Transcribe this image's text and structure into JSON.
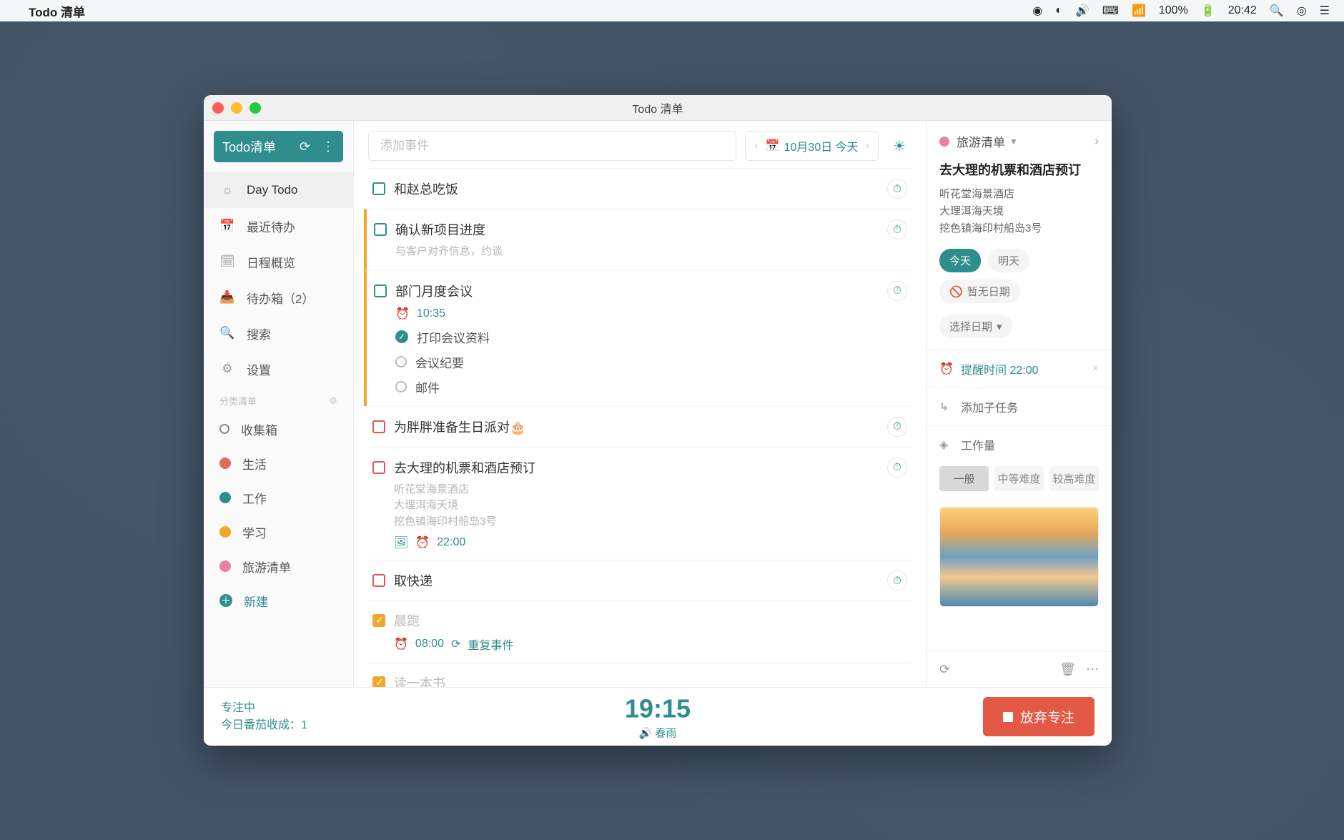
{
  "menubar": {
    "app_name": "Todo 清单",
    "battery": "100%",
    "time": "20:42"
  },
  "window": {
    "title": "Todo 清单"
  },
  "sidebar": {
    "brand": "Todo清单",
    "nav": [
      {
        "label": "Day Todo",
        "icon": "☼",
        "active": true
      },
      {
        "label": "最近待办",
        "icon": "📅"
      },
      {
        "label": "日程概览",
        "icon": "🗓"
      },
      {
        "label": "待办箱（2）",
        "icon": "📥"
      },
      {
        "label": "搜索",
        "icon": "🔍"
      },
      {
        "label": "设置",
        "icon": "⚙"
      }
    ],
    "categories_header": "分类清单",
    "categories": [
      {
        "label": "收集箱",
        "type": "outline"
      },
      {
        "label": "生活",
        "color": "#e06b5f"
      },
      {
        "label": "工作",
        "color": "#2f8d8d"
      },
      {
        "label": "学习",
        "color": "#f4a62a"
      },
      {
        "label": "旅游清单",
        "color": "#e97fa5"
      }
    ],
    "add_label": "新建"
  },
  "toolbar": {
    "placeholder": "添加事件",
    "date_label": "10月30日 今天"
  },
  "tasks": [
    {
      "title": "和赵总吃饭",
      "check": "teal"
    },
    {
      "title": "确认新项目进度",
      "check": "teal",
      "flag": true,
      "sub": "与客户对齐信息，约谈"
    },
    {
      "title": "部门月度会议",
      "check": "teal",
      "flag": true,
      "time": "10:35",
      "subtasks": [
        {
          "label": "打印会议资料",
          "done": true
        },
        {
          "label": "会议纪要",
          "done": false
        },
        {
          "label": "邮件",
          "done": false
        }
      ]
    },
    {
      "title": "为胖胖准备生日派对🎂",
      "check": "red"
    },
    {
      "title": "去大理的机票和酒店预订",
      "check": "red",
      "sub": "听花堂海景酒店\n大理洱海天境\n挖色镇海印村船岛3号",
      "has_image": true,
      "time": "22:00"
    },
    {
      "title": "取快递",
      "check": "red"
    },
    {
      "title": "晨跑",
      "check": "done",
      "muted": true,
      "time": "08:00",
      "repeat": "重复事件"
    },
    {
      "title": "读一本书",
      "check": "done",
      "muted": true
    }
  ],
  "detail": {
    "list_name": "旅游清单",
    "title": "去大理的机票和酒店预订",
    "desc": "听花堂海景酒店\n大理洱海天境\n挖色镇海印村船岛3号",
    "date_chips": {
      "today": "今天",
      "tomorrow": "明天",
      "none": "暂无日期",
      "pick": "选择日期"
    },
    "reminder_label": "提醒时间 22:00",
    "subtask_label": "添加子任务",
    "effort_label": "工作量",
    "difficulty": {
      "low": "一般",
      "mid": "中等难度",
      "high": "较高难度"
    }
  },
  "focus": {
    "status": "专注中",
    "count_label": "今日番茄收成：1",
    "timer": "19:15",
    "sound": "春雨",
    "abandon": "放弃专注"
  }
}
